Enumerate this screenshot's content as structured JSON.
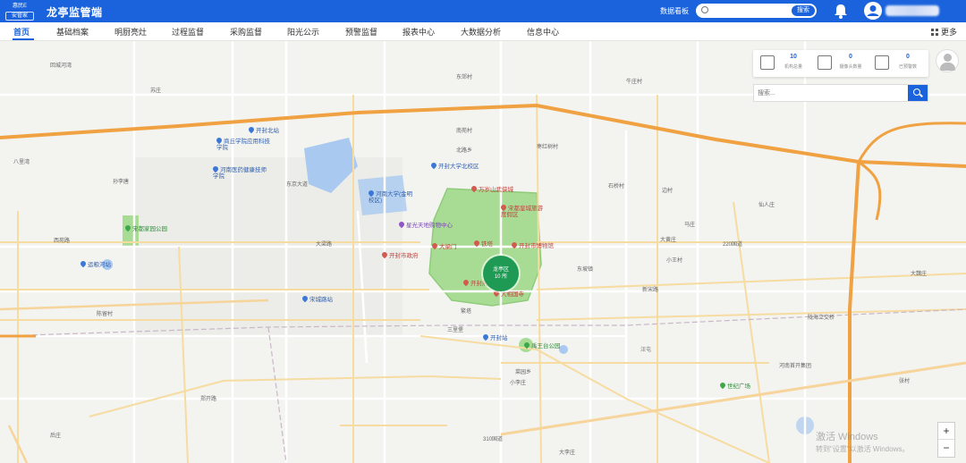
{
  "header": {
    "logo_top": "惠民E",
    "logo_bottom": "安管家",
    "title": "龙亭监管端",
    "dashboard_label": "数据看板",
    "search_placeholder": "",
    "search_button": "搜索"
  },
  "nav": {
    "items": [
      "首页",
      "基础档案",
      "明厨亮灶",
      "过程监督",
      "采购监督",
      "阳光公示",
      "预警监督",
      "报表中心",
      "大数据分析",
      "信息中心"
    ],
    "active_index": 0,
    "more": "更多"
  },
  "stats": [
    {
      "value": "10",
      "label": "机构总量",
      "icon": "building-icon"
    },
    {
      "value": "0",
      "label": "摄像头数量",
      "icon": "doc-search-icon"
    },
    {
      "value": "0",
      "label": "已预警数",
      "icon": "monitor-icon"
    }
  ],
  "map_search": {
    "placeholder": "搜索..."
  },
  "cluster": {
    "name": "龙亭区",
    "count": "10 所"
  },
  "pois": {
    "kaifeng_north": "开封北站",
    "business_college": "商丘学院应用科技学院",
    "medical_college": "河南医药健康技师学院",
    "univ_area": "开封大学北校区",
    "henan_univ": "河南大学(金明校区)",
    "wansui": "万岁山武侠城",
    "songdu": "宋都皇城旅游度假区",
    "city_park": "开封城墙公园",
    "zhongxing_mall": "星光天地购物中心",
    "dameng": "大梁门",
    "tiebe": "铁塔",
    "museum": "开封市博物馆",
    "city_gov": "开封市政府",
    "songcheng_park": "宋都家园公园",
    "chengdong": "运粮河站",
    "songcheng_station": "宋城路站",
    "kaifeng_station": "开封站",
    "temple": "大相国寺",
    "kaifeng_palace": "开封府",
    "yuwang_park": "禹王台公园",
    "shiji_square": "世纪广场"
  },
  "labels": {
    "l1": "回城河湾",
    "l2": "苏庄",
    "l3": "东郊村",
    "l4": "牛庄村",
    "l5": "南苑村",
    "l6": "西护城河",
    "l7": "北路乡",
    "l8": "枣红树村",
    "l9": "石桥村",
    "l10": "边村",
    "l11": "大黄庄",
    "l12": "东坡镇",
    "l13": "杜良乡",
    "l14": "新宋路",
    "l15": "东京大道",
    "l16": "西苑路",
    "l17": "大梁路",
    "l18": "繁塔",
    "l19": "汴京路",
    "l20": "郑开路",
    "l21": "小李庄",
    "l22": "东郊乡",
    "l23": "三里堡",
    "l24": "汪屯",
    "l25": "马庄",
    "l26": "菜园乡",
    "l27": "大李庄",
    "l28": "郭家",
    "l29": "小王村",
    "l30": "陇海立交桥",
    "l31": "河南首开集团",
    "l32": "张村",
    "l33": "八里湾",
    "l34": "孙李唐",
    "l35": "陈留村",
    "l36": "310国道",
    "l37": "220国道",
    "l38": "仙人庄",
    "l39": "大魏庄",
    "l40": "后庄"
  },
  "roads": {
    "g220": "220国道",
    "g310": "310国道"
  },
  "watermark": {
    "line1": "激活 Windows",
    "line2": "转到\"设置\"以激活 Windows。"
  },
  "zoom": {
    "in": "+",
    "out": "−"
  },
  "colors": {
    "brand": "#1a63dc",
    "highway": "#f0a142",
    "park": "#a8dc95",
    "water": "#a9c9f0",
    "cluster": "#1f9a54"
  }
}
